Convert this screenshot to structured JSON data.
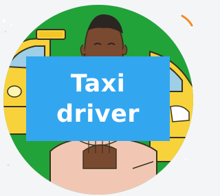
{
  "caption": {
    "line1": "Taxi",
    "line2": "driver"
  },
  "colors": {
    "badge_background": "#21a33a",
    "caption_background": "#33a6f0",
    "caption_text": "#ffffff",
    "taxi_yellow": "#f7d23b",
    "ring_accent": "#f28a20"
  },
  "icons": {
    "taxi_roof_sign": "taxi-sign-icon",
    "person": "person-illustration",
    "car": "taxi-car-illustration"
  }
}
